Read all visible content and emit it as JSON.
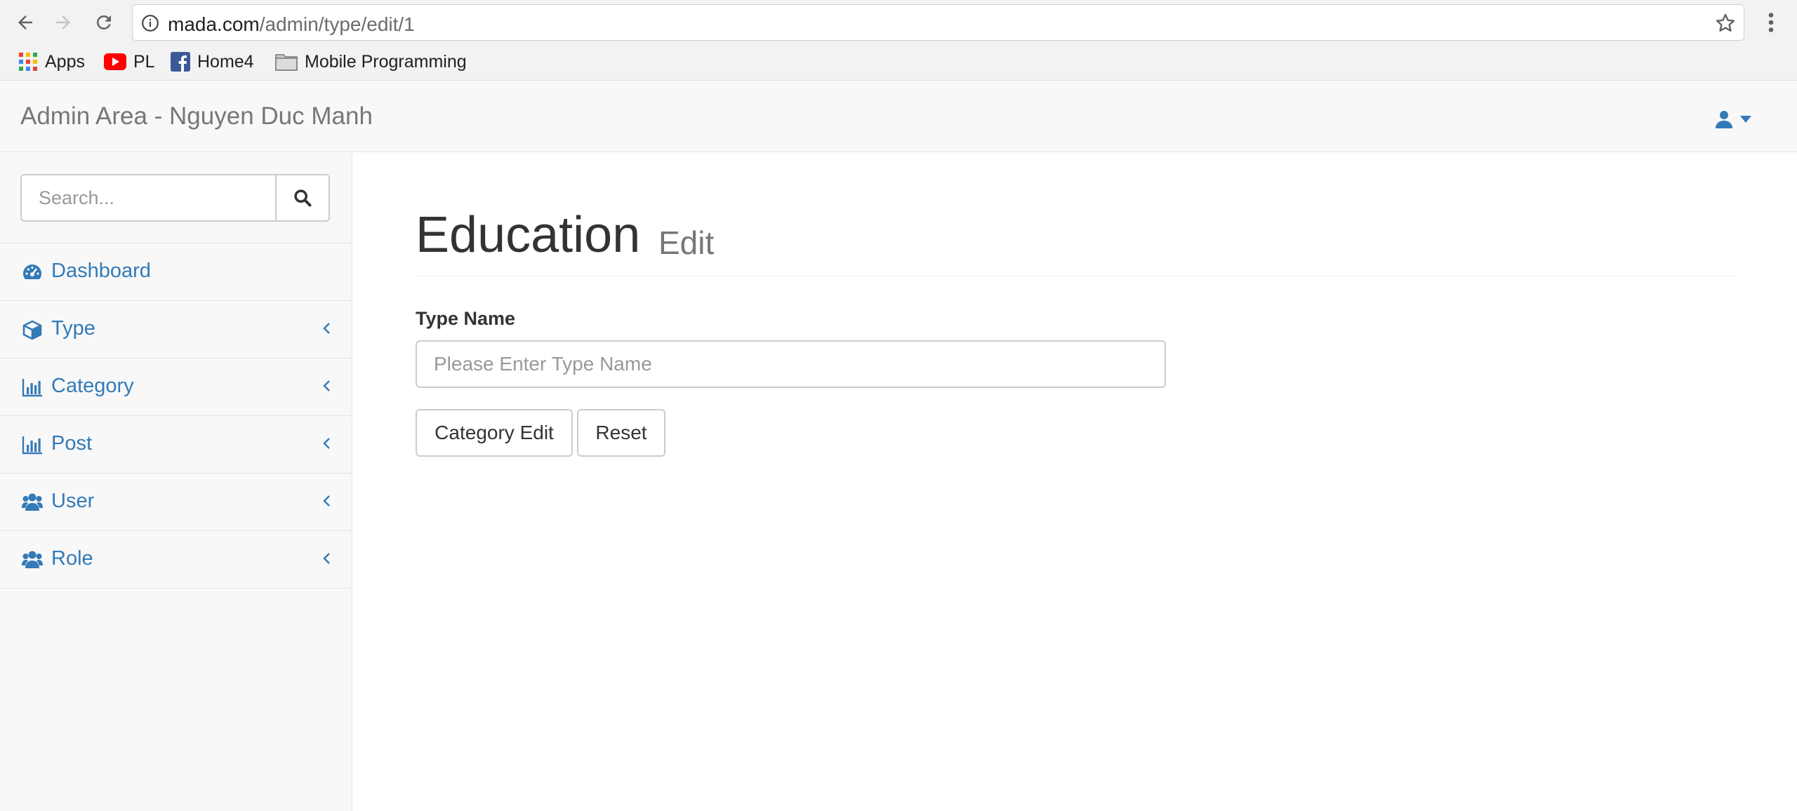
{
  "browser": {
    "url_host": "mada.com",
    "url_path": "/admin/type/edit/1",
    "bookmarks": [
      {
        "label": "Apps",
        "icon": "apps-grid-icon"
      },
      {
        "label": "PL",
        "icon": "youtube-icon"
      },
      {
        "label": "Home4",
        "icon": "facebook-icon"
      },
      {
        "label": "Mobile Programming",
        "icon": "folder-icon"
      }
    ]
  },
  "topbar": {
    "brand": "Admin Area - Nguyen Duc Manh",
    "user_icon": "user-icon",
    "accent": "#337ab7"
  },
  "sidebar": {
    "search_placeholder": "Search...",
    "items": [
      {
        "label": "Dashboard",
        "icon": "dashboard-icon",
        "has_chevron": false
      },
      {
        "label": "Type",
        "icon": "cube-icon",
        "has_chevron": true
      },
      {
        "label": "Category",
        "icon": "bar-chart-icon",
        "has_chevron": true
      },
      {
        "label": "Post",
        "icon": "bar-chart-icon",
        "has_chevron": true
      },
      {
        "label": "User",
        "icon": "users-icon",
        "has_chevron": true
      },
      {
        "label": "Role",
        "icon": "users-icon",
        "has_chevron": true
      }
    ]
  },
  "main": {
    "title": "Education",
    "subtitle": "Edit",
    "form": {
      "type_name_label": "Type Name",
      "type_name_value": "",
      "type_name_placeholder": "Please Enter Type Name",
      "submit_label": "Category Edit",
      "reset_label": "Reset"
    }
  }
}
